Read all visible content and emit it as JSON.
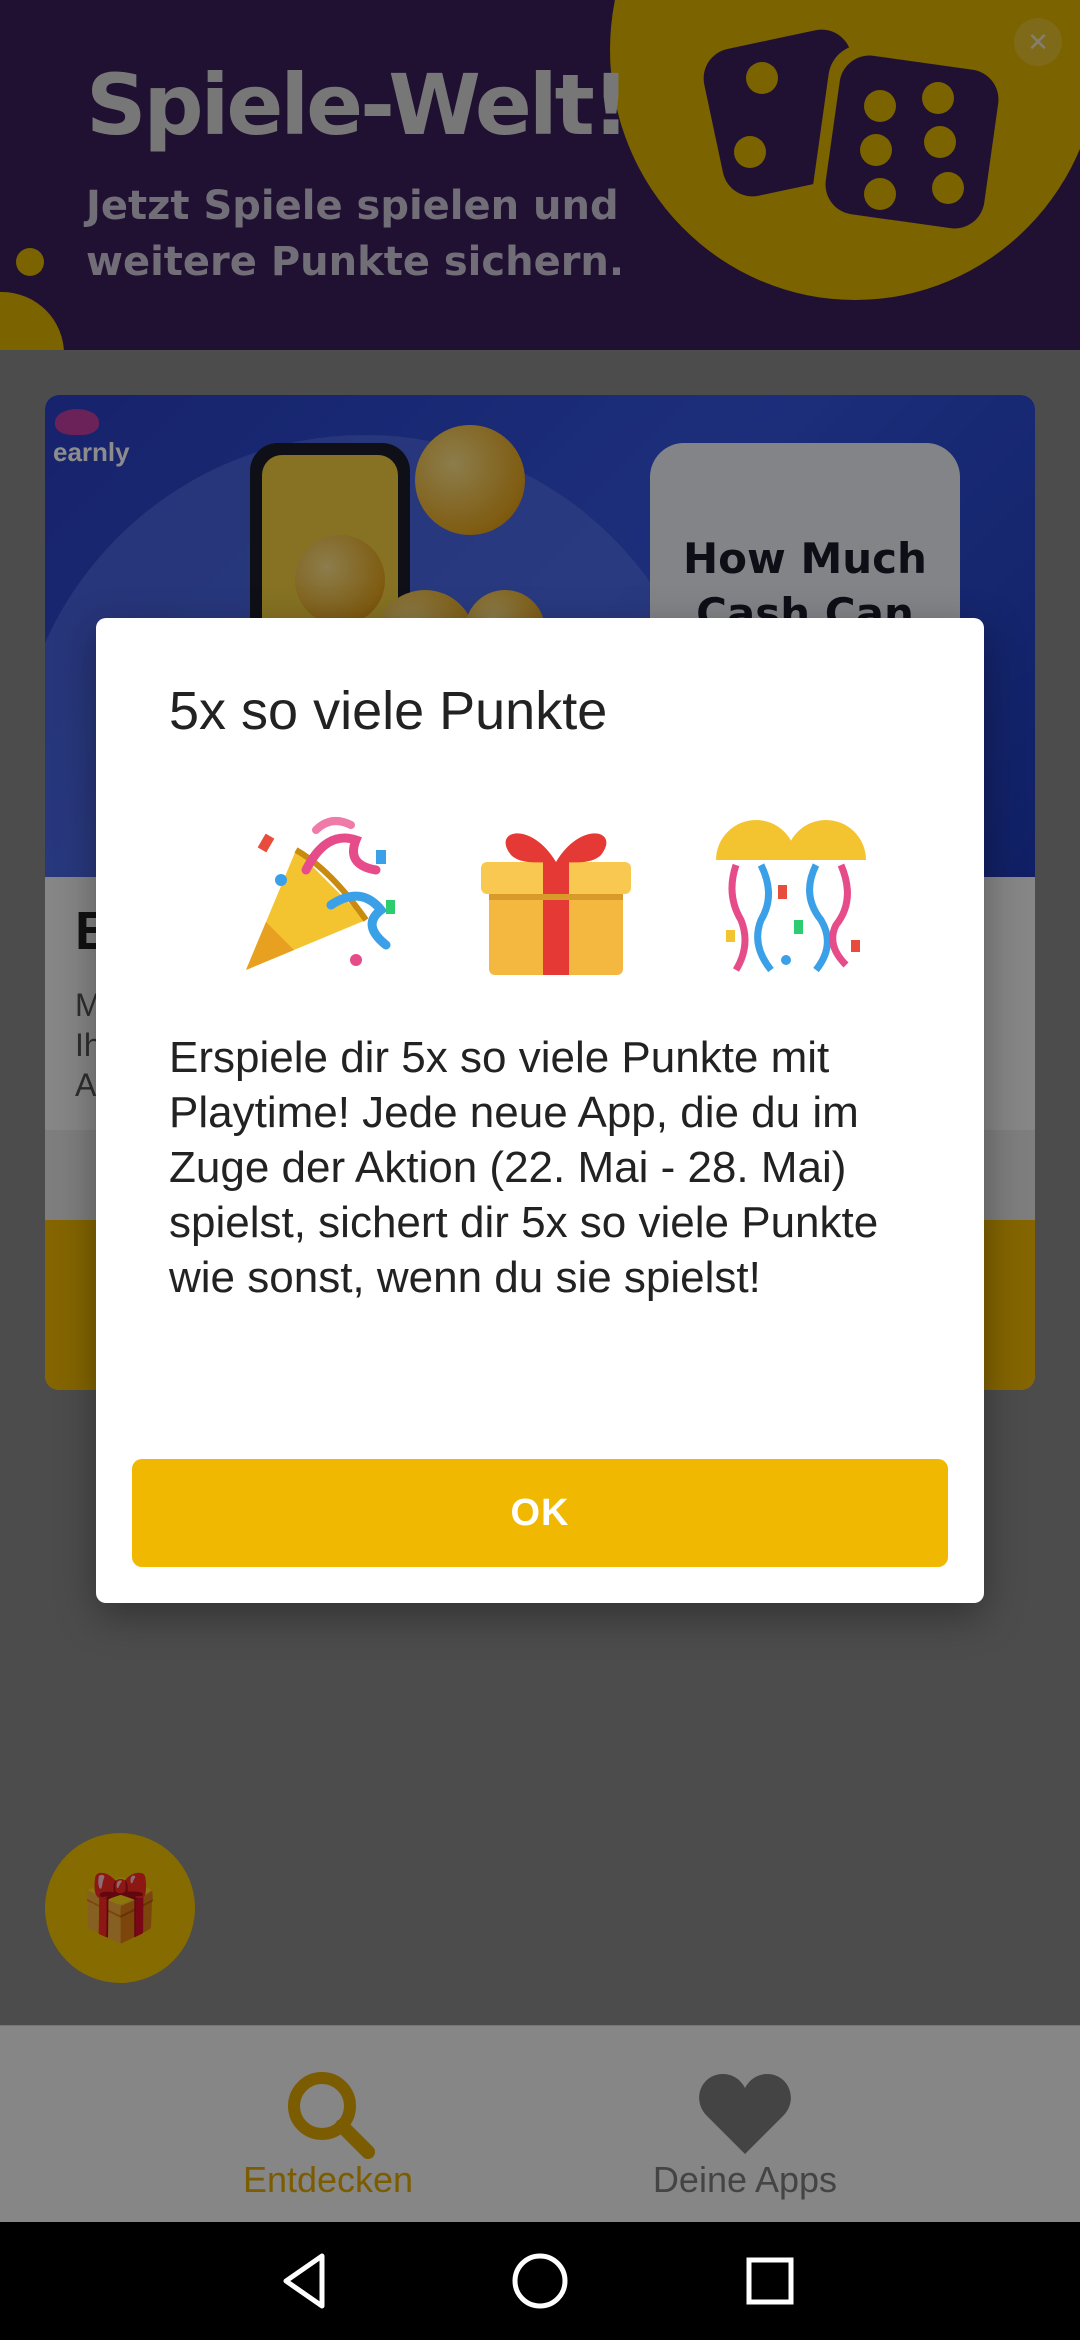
{
  "banner": {
    "title": "Spiele-Welt!",
    "subtitle": "Jetzt Spiele spielen und weitere Punkte sichern.",
    "close_glyph": "✕",
    "icons": [
      "dice-icon",
      "close-icon"
    ]
  },
  "card": {
    "brand": "earnly",
    "promo_text": "How Much Cash Can YOU Earn?",
    "heading_partial": "E",
    "text_partial": "M\nIh\nA"
  },
  "dialog": {
    "title": "5x so viele Punkte",
    "emojis": [
      "party-popper-icon",
      "gift-icon",
      "confetti-ball-icon"
    ],
    "body": "Erspiele dir 5x so viele Punkte mit Playtime! Jede neue App, die du im Zuge der Aktion (22. Mai - 28. Mai) spielst, sichert dir 5x so viele Punkte wie sonst, wenn du sie spielst!",
    "ok_label": "OK"
  },
  "fab": {
    "icon": "gift-icon"
  },
  "bottom_nav": {
    "items": [
      {
        "label": "Entdecken",
        "icon": "search-icon",
        "active": true
      },
      {
        "label": "Deine Apps",
        "icon": "heart-icon",
        "active": false
      }
    ]
  },
  "system_nav": {
    "buttons": [
      "back-icon",
      "home-icon",
      "recents-icon"
    ]
  },
  "colors": {
    "accent": "#f0b800",
    "banner_bg": "#3b1f5e",
    "banner_yellow": "#e0b400",
    "nav_active": "#e0a800",
    "nav_inactive": "#7c7c7c"
  }
}
